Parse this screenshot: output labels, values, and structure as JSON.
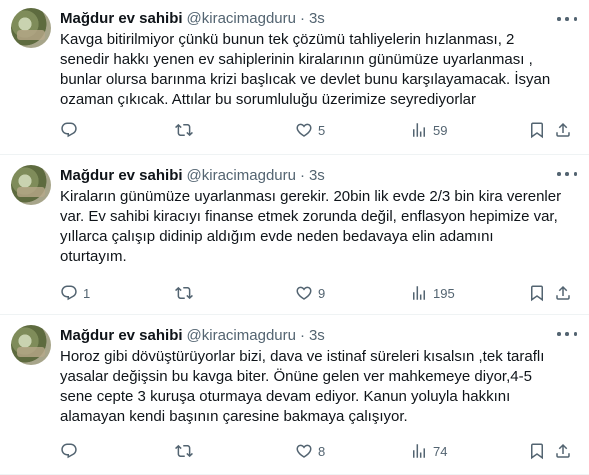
{
  "tweets": [
    {
      "name": "Mağdur ev sahibi",
      "handle": "@kiracimagduru",
      "dot": "·",
      "time": "3s",
      "lines": [
        "Kavga bitirilmiyor çünkü bunun tek çözümü tahliyelerin hızlanması, 2",
        "senedir hakkı yenen ev sahiplerinin kiralarının günümüze uyarlanması ,",
        " bunlar olursa barınma krizi başlıcak ve devlet bunu karşılayamacak. İsyan",
        "ozaman çıkıcak. Attılar bu sorumluluğu üzerimize seyrediyorlar"
      ],
      "replies": "",
      "retweets": "",
      "likes": "5",
      "views": "59"
    },
    {
      "name": "Mağdur ev sahibi",
      "handle": "@kiracimagduru",
      "dot": "·",
      "time": "3s",
      "lines": [
        "Kiraların günümüze uyarlanması gerekir. 20bin lik evde 2/3 bin kira verenler",
        "var. Ev sahibi kiracıyı finanse etmek zorunda değil, enflasyon hepimize var,",
        "yıllarca çalışıp didinip aldığım evde neden bedavaya elin adamını",
        "oturtayım."
      ],
      "replies": "1",
      "retweets": "",
      "likes": "9",
      "views": "195"
    },
    {
      "name": "Mağdur ev sahibi",
      "handle": "@kiracimagduru",
      "dot": "·",
      "time": "3s",
      "lines": [
        "Horoz gibi dövüştürüyorlar bizi, dava ve istinaf süreleri kısalsın ,tek taraflı",
        "yasalar değişsin bu kavga biter. Önüne gelen ver mahkemeye diyor,4-5",
        "sene cepte 3 kuruşa oturmaya devam ediyor. Kanun yoluyla hakkını",
        "alamayan kendi başının çaresine bakmaya çalışıyor."
      ],
      "replies": "",
      "retweets": "",
      "likes": "8",
      "views": "74"
    }
  ],
  "icons": {
    "reply": "reply-icon",
    "retweet": "retweet-icon",
    "like": "heart-icon",
    "views": "views-icon",
    "bookmark": "bookmark-icon",
    "share": "share-icon",
    "more": "more-icon"
  },
  "colors": {
    "text": "#0f1419",
    "secondary": "#536471",
    "divider": "#eff3f4"
  }
}
